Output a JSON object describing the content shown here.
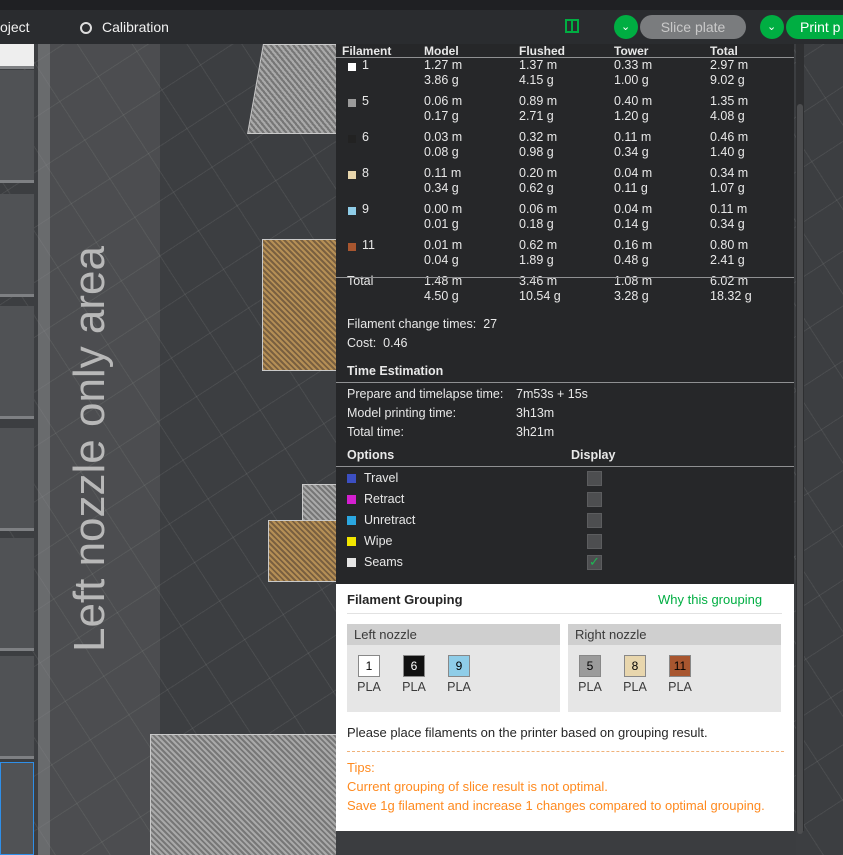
{
  "topbar": {
    "project_label": "oject",
    "calibration_label": "Calibration",
    "slice_plate_label": "Slice plate",
    "print_label": "Print p"
  },
  "scene": {
    "left_area_label": "Left nozzle only area"
  },
  "stats": {
    "headers": [
      "Filament",
      "Model",
      "Flushed",
      "Tower",
      "Total"
    ],
    "rows": [
      {
        "id": "1",
        "color": "#ffffff",
        "model": [
          "1.27 m",
          "3.86 g"
        ],
        "flushed": [
          "1.37 m",
          "4.15 g"
        ],
        "tower": [
          "0.33 m",
          "1.00 g"
        ],
        "total": [
          "2.97 m",
          "9.02 g"
        ]
      },
      {
        "id": "5",
        "color": "#9b9b9b",
        "model": [
          "0.06 m",
          "0.17 g"
        ],
        "flushed": [
          "0.89 m",
          "2.71 g"
        ],
        "tower": [
          "0.40 m",
          "1.20 g"
        ],
        "total": [
          "1.35 m",
          "4.08 g"
        ]
      },
      {
        "id": "6",
        "color": "#222222",
        "model": [
          "0.03 m",
          "0.08 g"
        ],
        "flushed": [
          "0.32 m",
          "0.98 g"
        ],
        "tower": [
          "0.11 m",
          "0.34 g"
        ],
        "total": [
          "0.46 m",
          "1.40 g"
        ]
      },
      {
        "id": "8",
        "color": "#e8d6ad",
        "model": [
          "0.11 m",
          "0.34 g"
        ],
        "flushed": [
          "0.20 m",
          "0.62 g"
        ],
        "tower": [
          "0.04 m",
          "0.11 g"
        ],
        "total": [
          "0.34 m",
          "1.07 g"
        ]
      },
      {
        "id": "9",
        "color": "#8fcde8",
        "model": [
          "0.00 m",
          "0.01 g"
        ],
        "flushed": [
          "0.06 m",
          "0.18 g"
        ],
        "tower": [
          "0.04 m",
          "0.14 g"
        ],
        "total": [
          "0.11 m",
          "0.34 g"
        ]
      },
      {
        "id": "11",
        "color": "#a8562f",
        "model": [
          "0.01 m",
          "0.04 g"
        ],
        "flushed": [
          "0.62 m",
          "1.89 g"
        ],
        "tower": [
          "0.16 m",
          "0.48 g"
        ],
        "total": [
          "0.80 m",
          "2.41 g"
        ]
      }
    ],
    "total_row": {
      "label": "Total",
      "model": [
        "1.48 m",
        "4.50 g"
      ],
      "flushed": [
        "3.46 m",
        "10.54 g"
      ],
      "tower": [
        "1.08 m",
        "3.28 g"
      ],
      "total": [
        "6.02 m",
        "18.32 g"
      ]
    },
    "change_times_label": "Filament change times:",
    "change_times_value": "27",
    "cost_label": "Cost:",
    "cost_value": "0.46"
  },
  "time": {
    "heading": "Time Estimation",
    "prepare_label": "Prepare and timelapse time:",
    "prepare_value": "7m53s + 15s",
    "model_label": "Model printing time:",
    "model_value": "3h13m",
    "total_label": "Total time:",
    "total_value": "3h21m"
  },
  "options": {
    "heading": "Options",
    "display_heading": "Display",
    "items": [
      {
        "label": "Travel",
        "color": "#3c4fc2",
        "checked": false
      },
      {
        "label": "Retract",
        "color": "#d41fd0",
        "checked": false
      },
      {
        "label": "Unretract",
        "color": "#2ba7e0",
        "checked": false
      },
      {
        "label": "Wipe",
        "color": "#f2e600",
        "checked": false
      },
      {
        "label": "Seams",
        "color": "#e6e6e6",
        "checked": true
      }
    ]
  },
  "grouping": {
    "title": "Filament Grouping",
    "why_link": "Why this grouping",
    "left_nozzle": {
      "label": "Left nozzle",
      "filaments": [
        {
          "id": "1",
          "color": "#ffffff",
          "text_color": "#000000",
          "material": "PLA"
        },
        {
          "id": "6",
          "color": "#111111",
          "text_color": "#ffffff",
          "material": "PLA"
        },
        {
          "id": "9",
          "color": "#8fcde8",
          "text_color": "#000000",
          "material": "PLA"
        }
      ]
    },
    "right_nozzle": {
      "label": "Right nozzle",
      "filaments": [
        {
          "id": "5",
          "color": "#9b9b9b",
          "text_color": "#000000",
          "material": "PLA"
        },
        {
          "id": "8",
          "color": "#e8d6ad",
          "text_color": "#000000",
          "material": "PLA"
        },
        {
          "id": "11",
          "color": "#a8562f",
          "text_color": "#000000",
          "material": "PLA"
        }
      ]
    },
    "instruction": "Please place filaments on the printer based on grouping result.",
    "tips_label": "Tips:",
    "tip_line1": "Current grouping of slice result is not optimal.",
    "tip_line2": "Save 1g filament and increase 1 changes compared to optimal grouping."
  }
}
